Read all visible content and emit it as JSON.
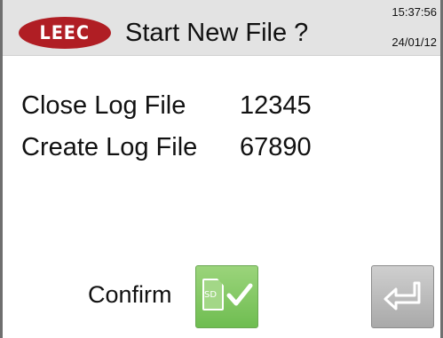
{
  "header": {
    "logo_text": "LEEC",
    "title": "Start New File ?",
    "time": "15:37:56",
    "date": "24/01/12"
  },
  "log": {
    "close_label": "Close Log File",
    "close_value": "12345",
    "create_label": "Create Log File",
    "create_value": "67890"
  },
  "confirm": {
    "label": "Confirm",
    "sd_text": "SD"
  },
  "colors": {
    "brand_red": "#b01e24",
    "confirm_green": "#7cc65c",
    "header_gray": "#e3e3e3",
    "back_gray": "#bdbdbd"
  },
  "icons": {
    "confirm": "sd-card-check-icon",
    "back": "return-arrow-icon"
  }
}
